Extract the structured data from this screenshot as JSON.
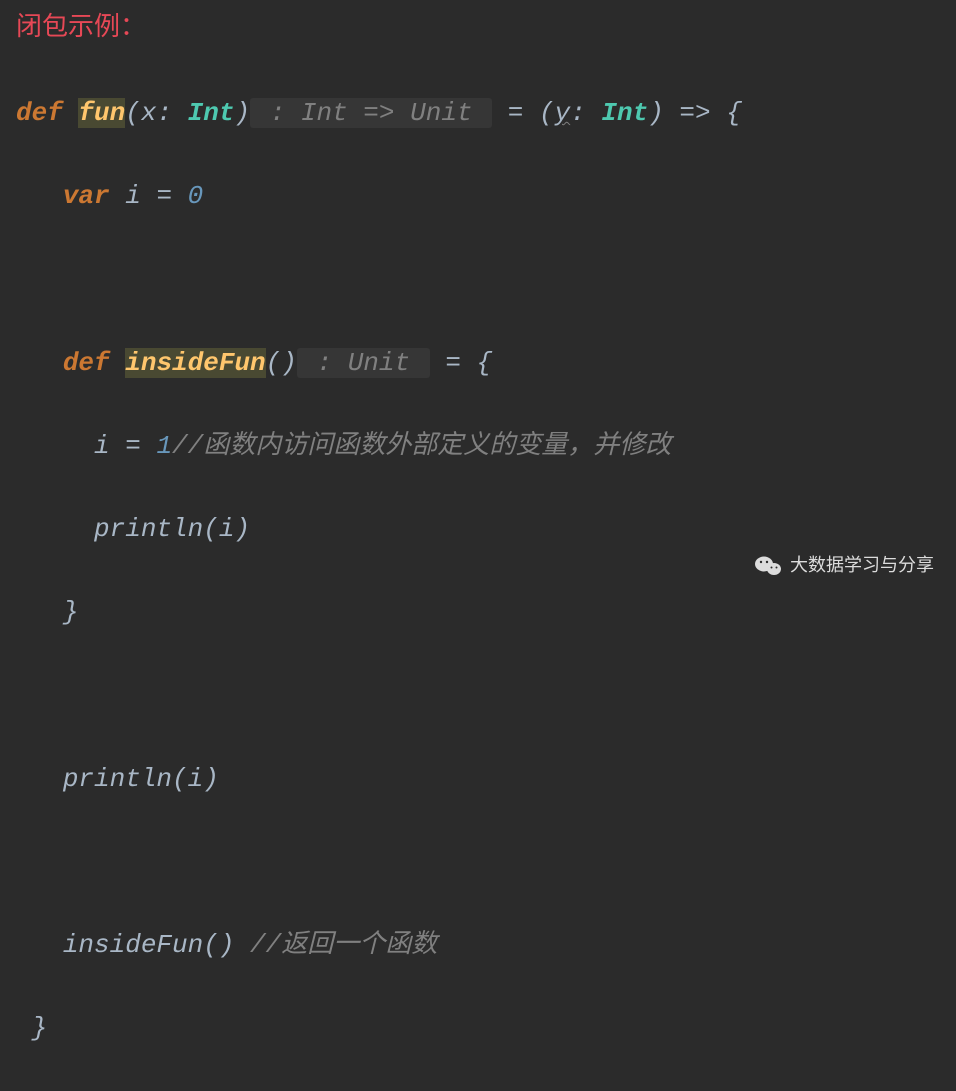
{
  "title": "闭包示例：",
  "code": {
    "l1": {
      "def": "def",
      "fn": "fun",
      "open_paren": "(",
      "param": "x",
      "colon": ": ",
      "type": "Int",
      "close_paren": ")",
      "hint": " : Int => Unit ",
      "eq": " = (",
      "param2": "y",
      "colon2": ": ",
      "type2": "Int",
      "arrow": ") => {"
    },
    "l2": {
      "var": "var",
      "ident": "i",
      "eq": " = ",
      "num": "0"
    },
    "l3": {
      "def": "def",
      "fn": "insideFun",
      "parens": "()",
      "hint": " : Unit ",
      "eq": " = {"
    },
    "l4": {
      "assign": "i = ",
      "num": "1",
      "comment": "//函数内访问函数外部定义的变量，并修改"
    },
    "l5": {
      "call": "println",
      "arg": "(i)"
    },
    "l6": {
      "brace": "}"
    },
    "l7": {
      "call": "println",
      "arg": "(i)"
    },
    "l8": {
      "call": "insideFun()",
      "comment": " //返回一个函数"
    },
    "l9": {
      "brace": "}"
    }
  },
  "watermark": "大数据学习与分享"
}
